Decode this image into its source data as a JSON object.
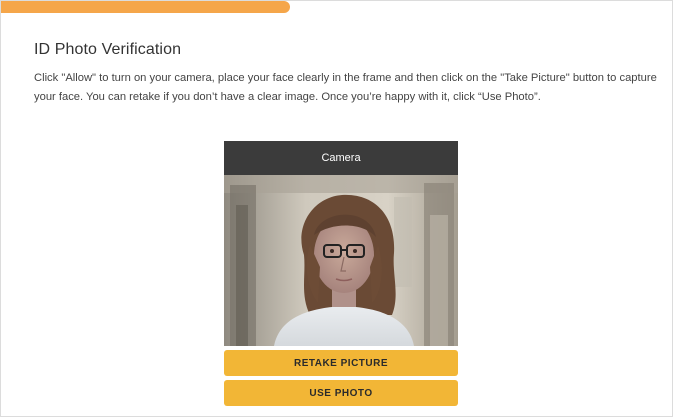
{
  "progress": {
    "value_fraction": 0.43,
    "color": "#f5a64a"
  },
  "page": {
    "title": "ID Photo Verification",
    "instructions": "Click \"Allow\" to turn on your camera, place your face clearly in the frame and then click on the \"Take Picture\" button to capture your face. You can retake if you don’t have a clear image. Once you’re happy with it, click “Use Photo”."
  },
  "camera": {
    "header_label": "Camera",
    "retake_label": "RETAKE PICTURE",
    "use_photo_label": "USE PHOTO",
    "button_color": "#f2b636",
    "header_color": "#3b3b3b"
  }
}
